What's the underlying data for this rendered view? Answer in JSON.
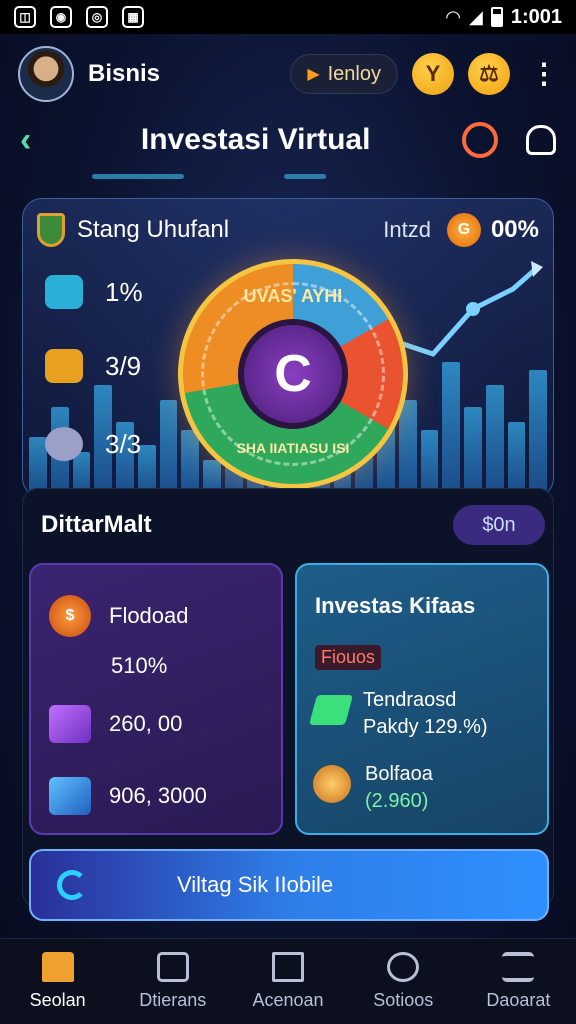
{
  "status_bar": {
    "time": "1:001"
  },
  "header": {
    "brand": "Bisnis",
    "pill_label": "Ienloy"
  },
  "title": "Investasi Virtual",
  "hero": {
    "name": "Stang Uhufanl",
    "sub_label": "Intzd",
    "percent": "00%",
    "stats": [
      "1%",
      "3/9",
      "3/3"
    ],
    "wheel_top_text": "UVAS' AYHI",
    "wheel_bottom_text": "SHA IIATIASU ISI",
    "wheel_center": "C"
  },
  "market": {
    "title": "DittarMalt",
    "badge": "$0n",
    "left_card": {
      "label": "Flodoad",
      "value1": "510%",
      "value2": "260, 00",
      "value3": "906, 3000"
    },
    "right_card": {
      "title": "Investas Kifaas",
      "tag": "Fiouos",
      "item1_line1": "Tendraosd",
      "item1_line2": "Pakdy 129.%)",
      "item2_line1": "Bolfaoa",
      "item2_line2": "(2.960)"
    },
    "cta_label": "Viltag Sik IIobile"
  },
  "nav": [
    "Seolan",
    "Dtierans",
    "Acenoan",
    "Sotioos",
    "Daoarat"
  ],
  "colors": {
    "accent": "#2e90ff",
    "positive": "#7df2a8",
    "gold": "#f5c542"
  }
}
